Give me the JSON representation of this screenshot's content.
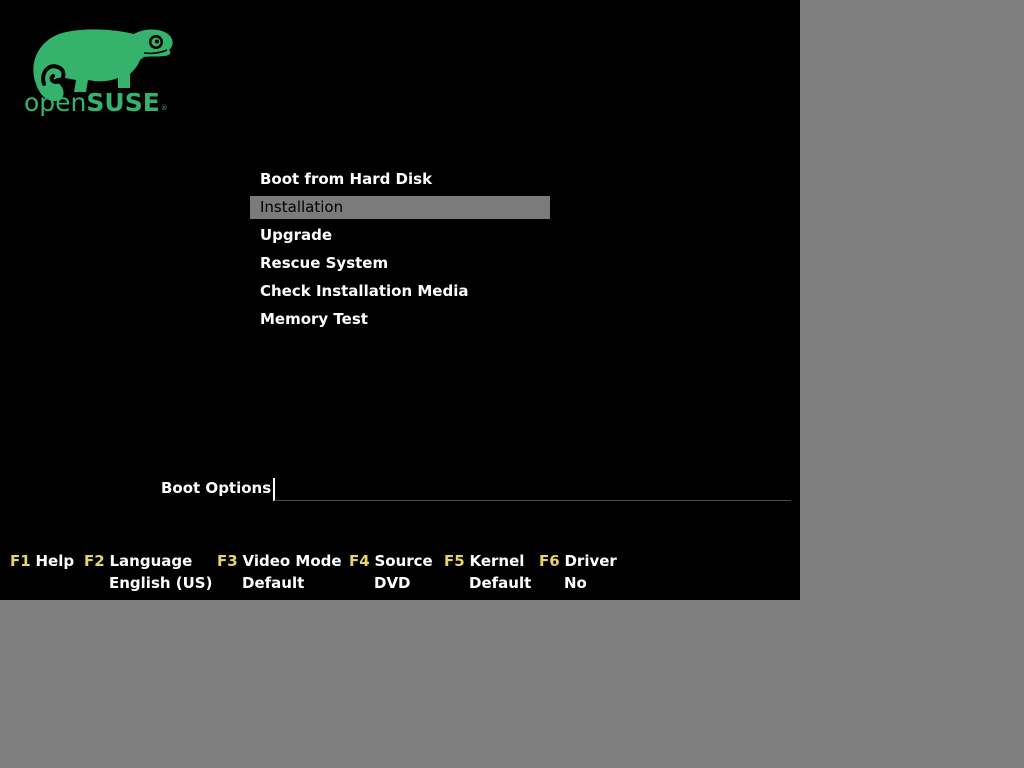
{
  "logo": {
    "text_open": "open",
    "text_suse": "SUSE",
    "reg": "®",
    "color": "#35b36d"
  },
  "menu": {
    "items": [
      {
        "label": "Boot from Hard Disk",
        "selected": false
      },
      {
        "label": "Installation",
        "selected": true
      },
      {
        "label": "Upgrade",
        "selected": false
      },
      {
        "label": "Rescue System",
        "selected": false
      },
      {
        "label": "Check Installation Media",
        "selected": false
      },
      {
        "label": "Memory Test",
        "selected": false
      }
    ]
  },
  "boot_options": {
    "label": "Boot Options",
    "value": ""
  },
  "function_keys": [
    {
      "key": "F1",
      "name": "Help",
      "value": ""
    },
    {
      "key": "F2",
      "name": "Language",
      "value": "English (US)"
    },
    {
      "key": "F3",
      "name": "Video Mode",
      "value": "Default"
    },
    {
      "key": "F4",
      "name": "Source",
      "value": "DVD"
    },
    {
      "key": "F5",
      "name": "Kernel",
      "value": "Default"
    },
    {
      "key": "F6",
      "name": "Driver",
      "value": "No"
    }
  ],
  "colors": {
    "screen_bg": "#000000",
    "outer_bg": "#7f7f7f",
    "selection": "#7b7b7b",
    "fkey_accent": "#e6d36a"
  }
}
